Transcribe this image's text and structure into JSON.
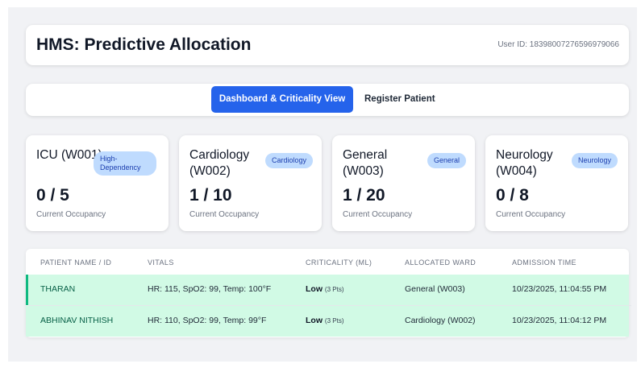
{
  "header": {
    "title": "HMS: Predictive Allocation",
    "user_id": "User ID: 18398007276596979066"
  },
  "tabs": [
    {
      "label": "Dashboard & Criticality View",
      "active": true
    },
    {
      "label": "Register Patient",
      "active": false
    }
  ],
  "wards": [
    {
      "name": "ICU (W001)",
      "badge": "High-Dependency",
      "occupancy": "0 / 5",
      "caption": "Current Occupancy"
    },
    {
      "name": "Cardiology (W002)",
      "badge": "Cardiology",
      "occupancy": "1 / 10",
      "caption": "Current Occupancy"
    },
    {
      "name": "General (W003)",
      "badge": "General",
      "occupancy": "1 / 20",
      "caption": "Current Occupancy"
    },
    {
      "name": "Neurology (W004)",
      "badge": "Neurology",
      "occupancy": "0 / 8",
      "caption": "Current Occupancy"
    }
  ],
  "table": {
    "columns": [
      "PATIENT NAME / ID",
      "VITALS",
      "CRITICALITY (ML)",
      "ALLOCATED WARD",
      "ADMISSION TIME"
    ],
    "rows": [
      {
        "name": "THARAN",
        "vitals": "HR: 115, SpO2: 99, Temp: 100°F",
        "criticality": "Low",
        "points": "(3 Pts)",
        "ward": "General (W003)",
        "time": "10/23/2025, 11:04:55 PM"
      },
      {
        "name": "ABHINAV NITHISH",
        "vitals": "HR: 110, SpO2: 99, Temp: 99°F",
        "criticality": "Low",
        "points": "(3 Pts)",
        "ward": "Cardiology (W002)",
        "time": "10/23/2025, 11:04:12 PM"
      }
    ]
  },
  "colors": {
    "primary": "#2563eb",
    "badge_bg": "#bfdbfe",
    "row_bg": "#d1fae5",
    "row_accent": "#10b981"
  }
}
